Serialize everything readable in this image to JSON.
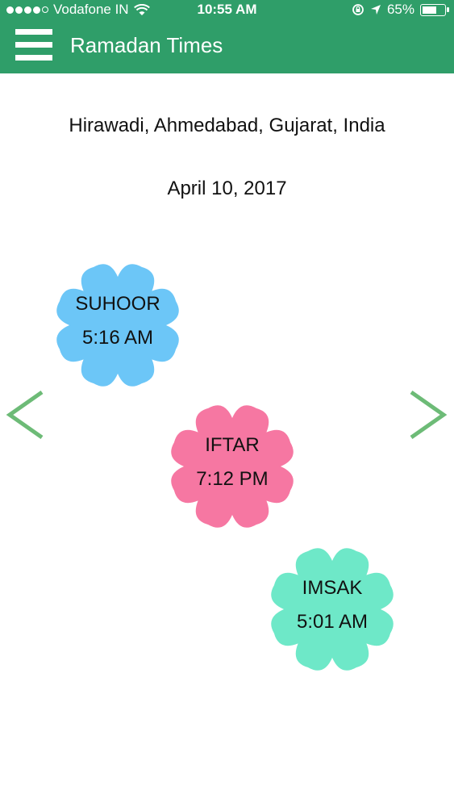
{
  "status_bar": {
    "carrier": "Vodafone IN",
    "time": "10:55 AM",
    "battery": "65%",
    "battery_level": 0.65,
    "signal_bars": 4,
    "signal_max": 5
  },
  "app_bar": {
    "title": "Ramadan Times"
  },
  "location": "Hirawadi, Ahmedabad, Gujarat, India",
  "date": "April 10, 2017",
  "times": [
    {
      "name": "SUHOOR",
      "time": "5:16 AM",
      "color": "#6cc6f7"
    },
    {
      "name": "IFTAR",
      "time": "7:12 PM",
      "color": "#f677a2"
    },
    {
      "name": "IMSAK",
      "time": "5:01 AM",
      "color": "#6ee8c8"
    }
  ],
  "colors": {
    "header": "#2f9e69",
    "arrow": "#6dbb77"
  },
  "icons": {
    "menu": "hamburger-menu-icon",
    "prev": "chevron-left-icon",
    "next": "chevron-right-icon"
  }
}
